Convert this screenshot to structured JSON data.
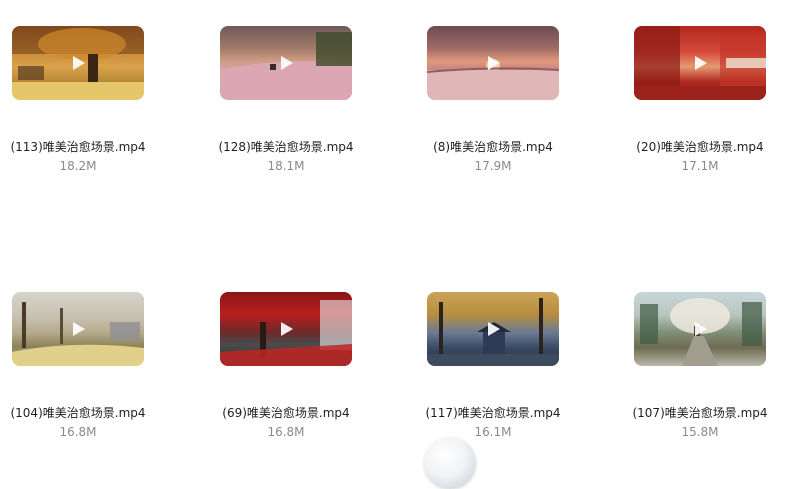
{
  "files": [
    {
      "name": "(113)唯美治愈场景.mp4",
      "size": "18.2M"
    },
    {
      "name": "(128)唯美治愈场景.mp4",
      "size": "18.1M"
    },
    {
      "name": "(8)唯美治愈场景.mp4",
      "size": "17.9M"
    },
    {
      "name": "(20)唯美治愈场景.mp4",
      "size": "17.1M"
    },
    {
      "name": "(104)唯美治愈场景.mp4",
      "size": "16.8M"
    },
    {
      "name": "(69)唯美治愈场景.mp4",
      "size": "16.8M"
    },
    {
      "name": "(117)唯美治愈场景.mp4",
      "size": "16.1M"
    },
    {
      "name": "(107)唯美治愈场景.mp4",
      "size": "15.8M"
    }
  ],
  "icons": {
    "play": "play-icon"
  }
}
